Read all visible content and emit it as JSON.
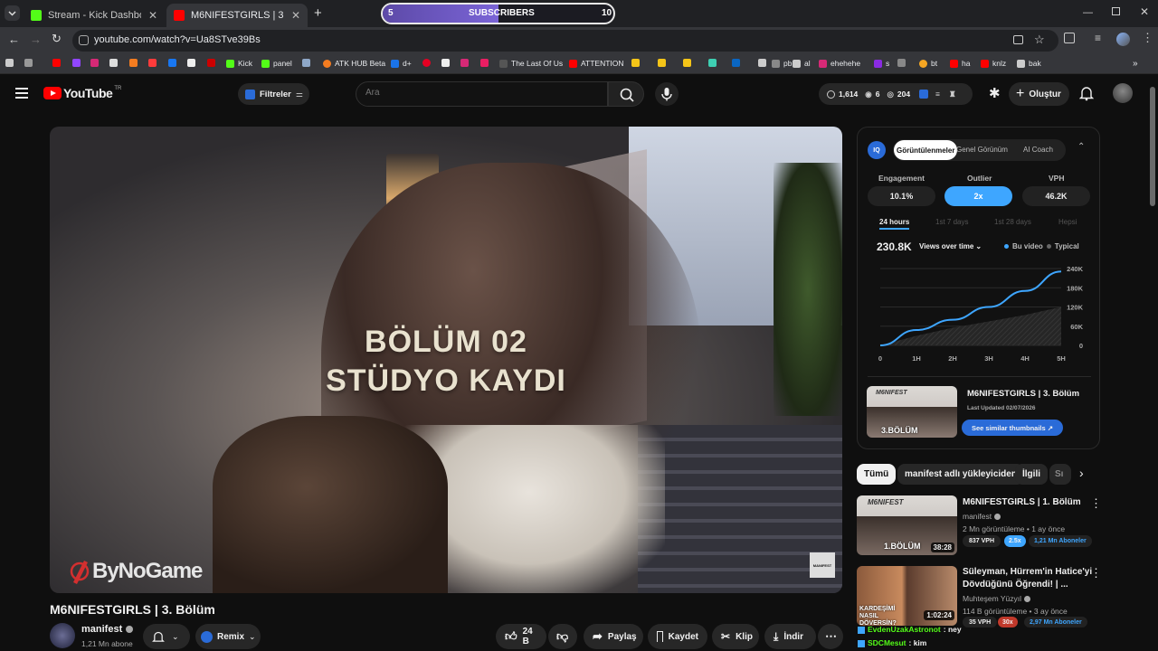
{
  "browser": {
    "tabs": [
      {
        "title": "Stream - Kick Dashboard",
        "favicon_color": "#53fc18"
      },
      {
        "title": "M6NIFESTGIRLS | 3. Bölüm - Yo",
        "favicon_color": "#ff0000"
      }
    ],
    "new_tab": "+",
    "subscriber_goal": {
      "current": "5",
      "label": "SUBSCRIBERS",
      "target": "10",
      "progress": 0.5
    },
    "url": "youtube.com/watch?v=Ua8STve39Bs",
    "bookmarks": [
      {
        "label": "Kick",
        "color": "#53fc18"
      },
      {
        "label": "panel",
        "color": "#53fc18"
      },
      {
        "label": "ATK HUB Beta",
        "color": "#f47c20"
      },
      {
        "label": "d+",
        "color": "#1a73e8"
      },
      {
        "label": "The Last Of Us",
        "color": "#555"
      },
      {
        "label": "ATTENTION",
        "color": "#ff0000"
      },
      {
        "label": "ehehehe",
        "color": "#d62976"
      },
      {
        "label": "s",
        "color": "#8a2be2"
      },
      {
        "label": "bt",
        "color": "#f5a623"
      },
      {
        "label": "ha",
        "color": "#ff0000"
      },
      {
        "label": "knlz",
        "color": "#ff0000"
      },
      {
        "label": "bak",
        "color": "#ccc"
      },
      {
        "label": "pb",
        "color": "#888"
      },
      {
        "label": "al",
        "color": "#ccc"
      }
    ]
  },
  "youtube": {
    "logo_text": "YouTube",
    "region": "TR",
    "filters_label": "Filtreler",
    "search_placeholder": "Ara",
    "stats": {
      "views": "1,614",
      "count2": "6",
      "count3": "204"
    },
    "create_label": "Oluştur"
  },
  "video": {
    "overlay_line1": "BÖLÜM 02",
    "overlay_line2": "STÜDYO KAYDI",
    "watermark": "ByNoGame",
    "corner_logo": "MANIFEST",
    "title": "M6NIFESTGIRLS | 3. Bölüm",
    "channel": "manifest",
    "subscribers": "1,21 Mn abone",
    "remix_label": "Remix",
    "likes": "24 B",
    "share_label": "Paylaş",
    "save_label": "Kaydet",
    "clip_label": "Klip",
    "download_label": "İndir"
  },
  "iq_panel": {
    "tabs": [
      "Görüntülenmeler",
      "Genel Görünüm",
      "AI Coach"
    ],
    "metrics": [
      {
        "label": "Engagement",
        "value": "10.1%"
      },
      {
        "label": "Outlier",
        "value": "2x"
      },
      {
        "label": "VPH",
        "value": "46.2K"
      }
    ],
    "ranges": [
      "24 hours",
      "1st 7 days",
      "1st 28 days",
      "Hepsi"
    ],
    "total_views": "230.8K",
    "view_mode": "Views over time",
    "legend": [
      "Bu video",
      "Typical"
    ],
    "thumb_title": "M6NIFESTGIRLS | 3. Bölüm",
    "last_updated": "Last Updated 02/07/2026",
    "thumb_text": "3.BÖLÜM",
    "similar_label": "See similar thumbnails ↗"
  },
  "chart_data": {
    "type": "area",
    "x": [
      "0",
      "1H",
      "2H",
      "3H",
      "4H",
      "5H"
    ],
    "series": [
      {
        "name": "Bu video",
        "values": [
          0,
          48000,
          80000,
          120000,
          170000,
          230800
        ],
        "color": "#3ea6ff"
      },
      {
        "name": "Typical",
        "values": [
          0,
          30000,
          55000,
          75000,
          95000,
          120000
        ],
        "color": "#555"
      }
    ],
    "yticks": [
      "240K",
      "180K",
      "120K",
      "60K",
      "0"
    ],
    "ylim": [
      0,
      240000
    ],
    "grid": true
  },
  "chips": [
    "Tümü",
    "manifest adlı yükleyiciden",
    "İlgili",
    "Sı"
  ],
  "related": [
    {
      "title": "M6NIFESTGIRLS | 1. Bölüm",
      "channel": "manifest",
      "meta": "2 Mn görüntüleme • 1 ay önce",
      "vph": "837 VPH",
      "outlier": "2.5x",
      "subs": "1,21 Mn Aboneler",
      "duration": "38:28",
      "thumb_text": "1.BÖLÜM"
    },
    {
      "title_line1": "Süleyman, Hürrem'in Hatice'yi",
      "title_line2": "Dövdüğünü Öğrendi! | ...",
      "channel": "Muhteşem Yüzyıl",
      "meta": "114 B görüntüleme • 3 ay önce",
      "vph": "35 VPH",
      "outlier": "30x",
      "subs": "2,97 Mn Aboneler",
      "duration": "1:02:24",
      "thumb_text": "KARDEŞİMİ NASIL DÖVERSİN?"
    }
  ],
  "chat": [
    {
      "user": "EvdenUzakAstronot",
      "msg": ": ney"
    },
    {
      "user": "SDCMesut",
      "msg": ": kim"
    }
  ]
}
